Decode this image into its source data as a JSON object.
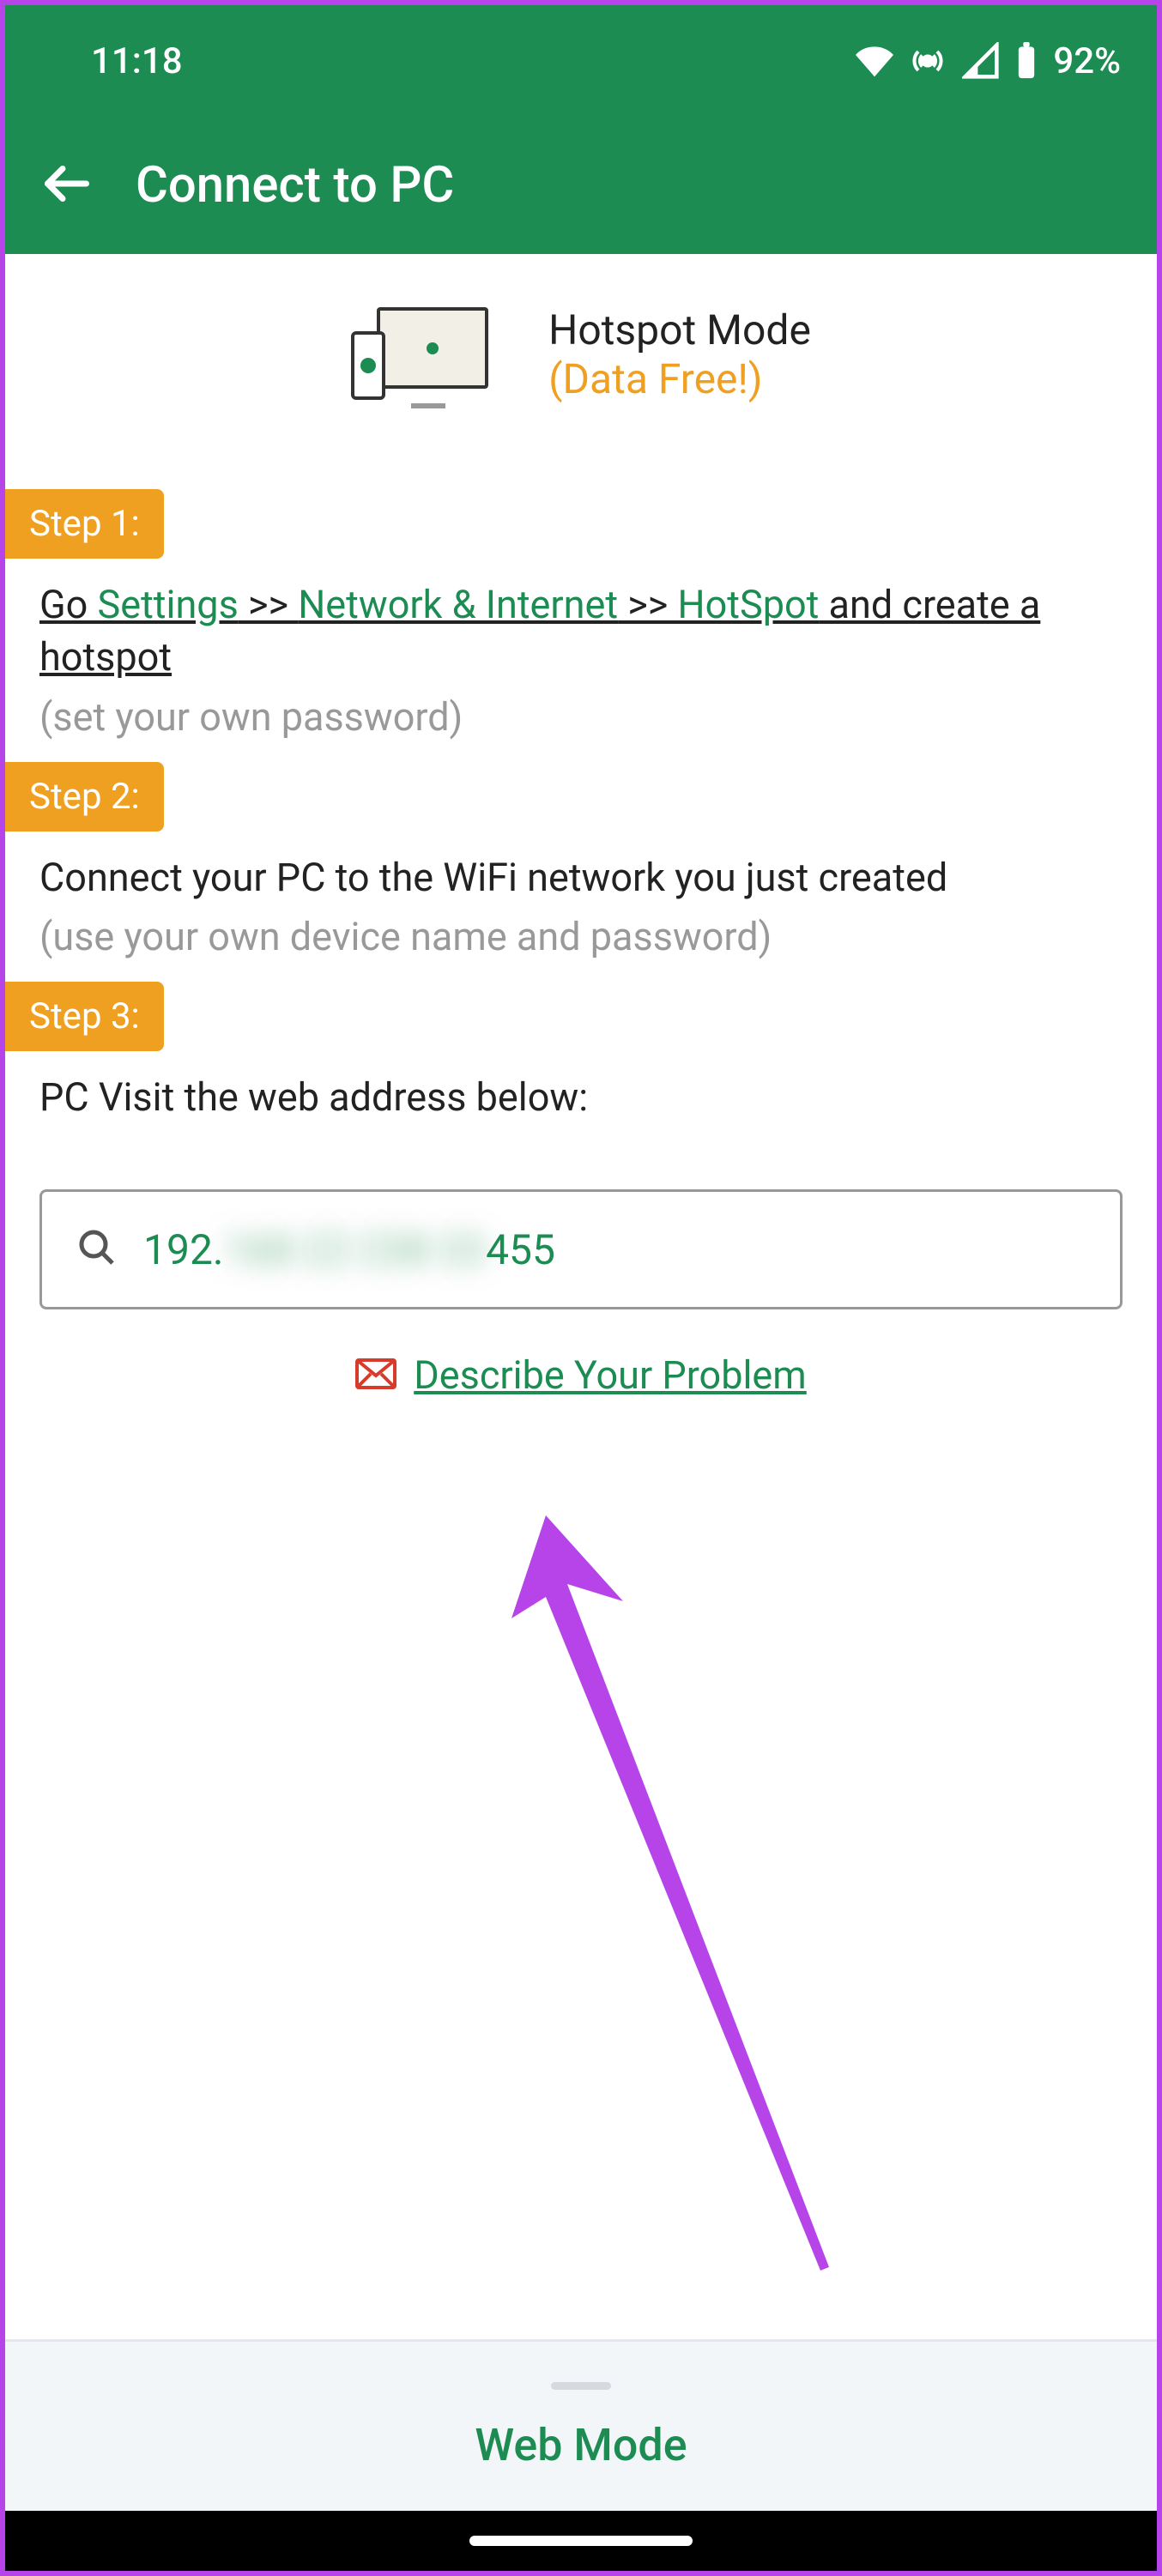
{
  "status": {
    "time": "11:18",
    "battery": "92%"
  },
  "appbar": {
    "title": "Connect to PC"
  },
  "mode": {
    "title": "Hotspot Mode",
    "subtitle": "(Data Free!)"
  },
  "steps": {
    "s1": {
      "badge": "Step 1:",
      "pre": "Go ",
      "link1": "Settings",
      "sep1": " >> ",
      "link2": "Network & Internet",
      "sep2": " >> ",
      "link3": "HotSpot",
      "post": " and create a hotspot",
      "hint": "(set your own password)"
    },
    "s2": {
      "badge": "Step 2:",
      "text": "Connect your PC to the WiFi network you just created",
      "hint": "(use your own device name and password)"
    },
    "s3": {
      "badge": "Step 3:",
      "text": "PC Visit the web address below:"
    }
  },
  "address": {
    "visible_prefix": "192.",
    "blurred_mid": "168 22 238 33",
    "visible_suffix": "455"
  },
  "problem": {
    "label": "Describe Your Problem"
  },
  "bottom": {
    "label": "Web Mode"
  }
}
